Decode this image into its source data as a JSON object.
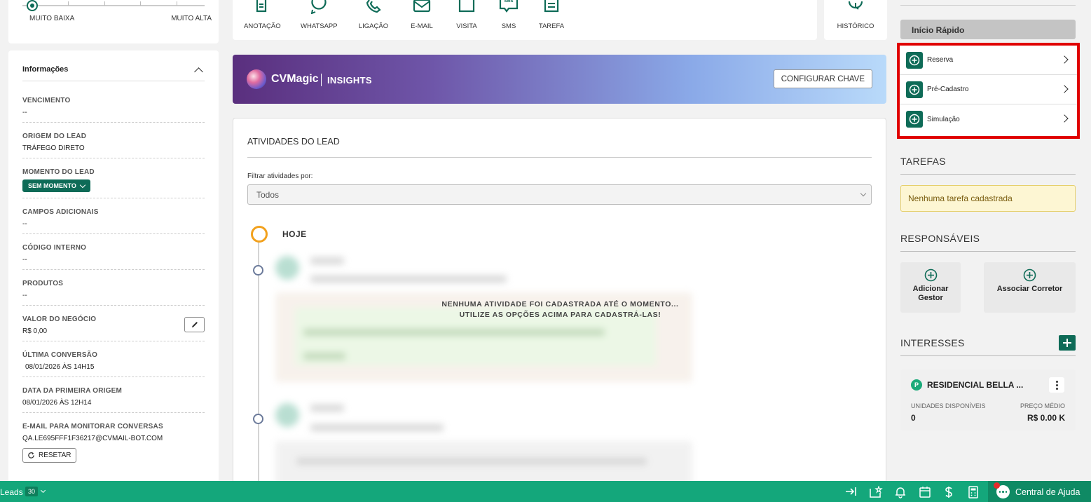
{
  "priority_slider": {
    "min_label": "MUITO BAIXA",
    "max_label": "MUITO ALTA",
    "selected_level": 0
  },
  "info": {
    "title": "Informações",
    "fields": {
      "vencimento": {
        "label": "VENCIMENTO",
        "value": "--"
      },
      "origem": {
        "label": "ORIGEM DO LEAD",
        "value": "TRÁFEGO DIRETO"
      },
      "momento": {
        "label": "MOMENTO DO LEAD",
        "value": "SEM MOMENTO"
      },
      "campos": {
        "label": "CAMPOS ADICIONAIS",
        "value": "--"
      },
      "codigo": {
        "label": "CÓDIGO INTERNO",
        "value": "--"
      },
      "produtos": {
        "label": "PRODUTOS",
        "value": "--"
      },
      "valor": {
        "label": "VALOR DO NEGÓCIO",
        "value": "R$ 0,00"
      },
      "ultima": {
        "label": "ÚLTIMA CONVERSÃO",
        "value": "08/01/2026 ÀS 14H15"
      },
      "primeira": {
        "label": "DATA DA PRIMEIRA ORIGEM",
        "value": "08/01/2026 ÀS 12H14"
      },
      "email": {
        "label": "E-MAIL PARA MONITORAR CONVERSAS",
        "value": "QA.LE695FFF1F36217@CVMAIL-BOT.COM"
      }
    },
    "reset_label": "RESETAR"
  },
  "actions": [
    "ANOTAÇÃO",
    "WHATSAPP",
    "LIGAÇÃO",
    "E-MAIL",
    "VISITA",
    "SMS",
    "TAREFA"
  ],
  "history_label": "HISTÓRICO",
  "banner": {
    "brand": "CVMagic",
    "product": "INSIGHTS",
    "button": "CONFIGURAR CHAVE"
  },
  "activities": {
    "title": "ATIVIDADES DO LEAD",
    "filter_label": "Filtrar atividades por:",
    "filter_value": "Todos",
    "today": "HOJE",
    "empty_line1": "NENHUMA ATIVIDADE FOI CADASTRADA ATÉ O MOMENTO...",
    "empty_line2": "UTILIZE AS OPÇÕES ACIMA PARA CADASTRÁ-LAS!"
  },
  "quick_start": {
    "title": "Início Rápido",
    "items": [
      "Reserva",
      "Pré-Cadastro",
      "Simulação"
    ],
    "highlight_color": "#e00000"
  },
  "tarefas": {
    "title": "TAREFAS",
    "empty": "Nenhuma tarefa cadastrada"
  },
  "responsaveis": {
    "title": "RESPONSÁVEIS",
    "add_gestor_l1": "Adicionar",
    "add_gestor_l2": "Gestor",
    "assoc_corretor": "Associar Corretor"
  },
  "interesses": {
    "title": "INTERESSES",
    "badge": "P",
    "name": "RESIDENCIAL BELLA ...",
    "units_label": "UNIDADES DISPONÍVEIS",
    "units_value": "0",
    "price_label": "PREÇO MÉDIO",
    "price_value": "R$ 0.00 K"
  },
  "bottombar": {
    "leads_label": "Leads",
    "leads_count": "30",
    "help_label": "Central de Ajuda",
    "color": "#14a77b"
  },
  "colors": {
    "primary": "#0e6b57",
    "warning_bg": "#fdf6d3",
    "timeline_today": "#f2a11d"
  }
}
